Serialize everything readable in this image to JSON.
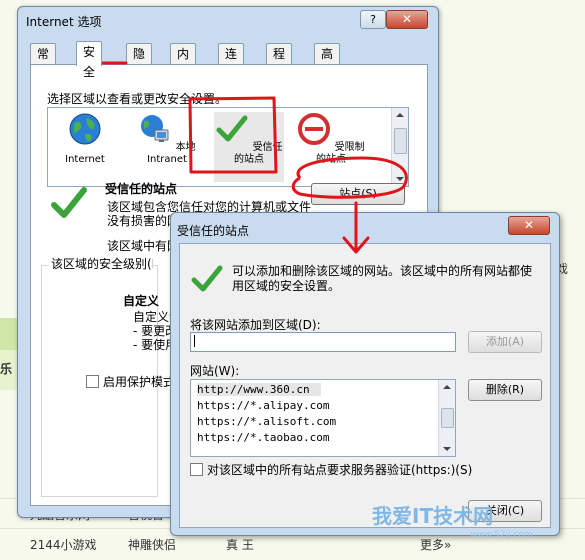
{
  "dialog": {
    "title": "Internet 选项",
    "help": "?",
    "close": "✕",
    "tabs": [
      "常规",
      "安全",
      "隐私",
      "内容",
      "连接",
      "程序",
      "高级"
    ],
    "zone_prompt": "选择区域以查看或更改安全设置。",
    "zones": [
      {
        "label": "Internet",
        "icon": "globe-icon"
      },
      {
        "label": "本地\nIntranet",
        "icon": "intranet-icon"
      },
      {
        "label": "受信任的站点",
        "icon": "check-icon"
      },
      {
        "label": "受限制的站点",
        "icon": "restricted-icon"
      }
    ],
    "trusted_title": "受信任的站点",
    "trusted_desc": "该区域包含您信任对您的计算机或文件没有损害的网站。",
    "trusted_desc2": "该区域中有网",
    "sites_button": "站点(S)",
    "security_level": "该区域的安全级别(L)",
    "custom_title": "自定义",
    "custom_lines": [
      "自定义设置",
      "- 要更改",
      "- 要使用"
    ],
    "protected_mode": "启用保护模式"
  },
  "trusted_sites": {
    "title": "受信任的站点",
    "close": "✕",
    "info": "可以添加和删除该区域的网站。该区域中的所有网站都使用区域的安全设置。",
    "add_label": "将该网站添加到区域(D):",
    "add_value": "",
    "add_button": "添加(A)",
    "sites_label": "网站(W):",
    "sites": [
      "http://www.360.cn",
      "https://*.alipay.com",
      "https://*.alisoft.com",
      "https://*.taobao.com"
    ],
    "remove_button": "删除(R)",
    "verify_label": "对该区域中的所有站点要求服务器验证(https:)(S)",
    "close_button": "关闭(C)"
  },
  "background": {
    "items": [
      "九酷音乐网",
      "音悦台",
      "2144小游戏",
      "神雕侠侣",
      "真 王",
      "更多»",
      "戏"
    ],
    "left_tab": "乐"
  },
  "watermark": {
    "main": "我爱IT技术网",
    "sub": "www.52ij.com"
  }
}
